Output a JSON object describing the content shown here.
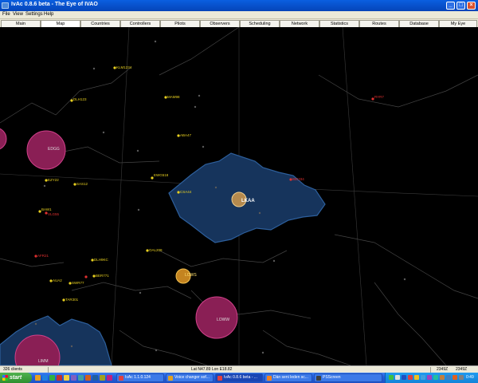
{
  "window": {
    "title": "IvAc 0.8.6 beta - The Eye of IVAO",
    "min_glyph": "_",
    "max_glyph": "□",
    "close_glyph": "×"
  },
  "menu": [
    "File",
    "View",
    "Settings",
    "Help"
  ],
  "tabs": [
    "Main",
    "Map",
    "Countries",
    "Controllers",
    "Pilots",
    "Observers",
    "Scheduling",
    "Network",
    "Statistics",
    "Routes",
    "Database",
    "My Eye"
  ],
  "active_tab": "Map",
  "map": {
    "labels": {
      "czech_controller": "LKAA",
      "vienna": "LOWW",
      "pink_left": "EDGG",
      "pink_bottom_left": "LIMM",
      "orange_station": "LOWS"
    },
    "pilots": [
      "KLM1234",
      "DLH123",
      "MAM98",
      "ABA47",
      "EWG518",
      "CSA44",
      "BAW1",
      "DLH9KC",
      "OAL209",
      "AUA2",
      "SWR77",
      "TAR301",
      "EZY22",
      "SAS12",
      "RYR7",
      "IBE334",
      "BER771",
      "AFR21",
      "VLG55"
    ]
  },
  "status": {
    "clients": "326 clients",
    "coords": "Lat N47.89 Lon E18.82",
    "time1": "2349Z",
    "time2": "2349Z"
  },
  "taskbar": {
    "start": "start",
    "tasks": [
      "IvAc 1.1.0.124",
      "Voice changer sof...",
      "IvAc 0.8.6 beta - ...",
      "Dàn seni leden sc...",
      "PSScreen"
    ],
    "clock": "0:49"
  }
}
